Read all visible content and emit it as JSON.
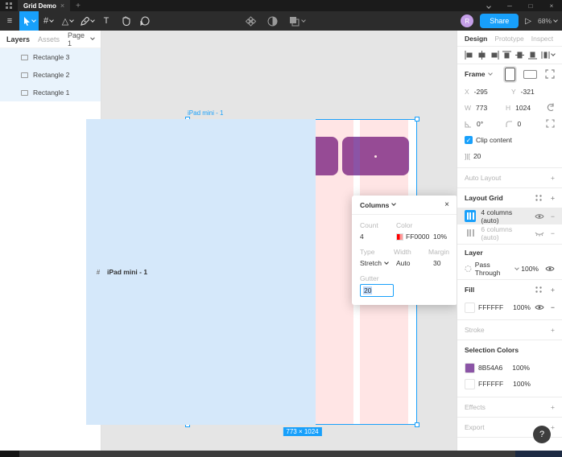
{
  "titlebar": {
    "tab": "Grid Demo",
    "close_tab": "×",
    "new_tab": "+",
    "window": {
      "minimize": "─",
      "maximize": "□",
      "close": "×"
    }
  },
  "toolbar": {
    "menu": "≡",
    "frame_tool": "#",
    "shape_tool": "△",
    "text_tool": "T",
    "avatar": "R",
    "share": "Share",
    "present": "▷",
    "zoom": "68%"
  },
  "left_sidebar": {
    "tabs": [
      "Layers",
      "Assets"
    ],
    "page": "Page 1",
    "layers": [
      "iPad mini - 1",
      "Rectangle 3",
      "Rectangle 2",
      "Rectangle 1"
    ]
  },
  "canvas": {
    "frame_label": "iPad mini - 1",
    "size_badge": "773 × 1024"
  },
  "columns_popup": {
    "title": "Columns",
    "close": "×",
    "count_label": "Count",
    "color_label": "Color",
    "count": "4",
    "color_hex": "FF0000",
    "color_opacity": "10%",
    "type_label": "Type",
    "width_label": "Width",
    "margin_label": "Margin",
    "type": "Stretch",
    "width": "Auto",
    "margin": "30",
    "gutter_label": "Gutter",
    "gutter": "20"
  },
  "inspector": {
    "tabs": [
      "Design",
      "Prototype",
      "Inspect"
    ],
    "frame": {
      "title": "Frame",
      "x_label": "X",
      "x": "-295",
      "y_label": "Y",
      "y": "-321",
      "w_label": "W",
      "w": "773",
      "h_label": "H",
      "h": "1024",
      "rotation": "0°",
      "radius": "0",
      "clip_label": "Clip content",
      "gutter_icon": "]|[",
      "gutter": "20"
    },
    "auto_layout_label": "Auto Layout",
    "layout_grid": {
      "title": "Layout Grid",
      "rows": [
        {
          "label": "4 columns (auto)"
        },
        {
          "label": "6 columns (auto)"
        }
      ]
    },
    "layer": {
      "title": "Layer",
      "blend": "Pass Through",
      "opacity": "100%"
    },
    "fill": {
      "title": "Fill",
      "hex": "FFFFFF",
      "opacity": "100%"
    },
    "stroke_label": "Stroke",
    "selection_colors": {
      "title": "Selection Colors",
      "items": [
        {
          "hex": "8B54A6",
          "opacity": "100%"
        },
        {
          "hex": "FFFFFF",
          "opacity": "100%"
        }
      ]
    },
    "effects_label": "Effects",
    "export_label": "Export"
  },
  "help": "?",
  "colors": {
    "accent": "#18A0FB",
    "selection_purple": "#8B54A6",
    "grid_red": "#FF0000",
    "fill_white": "#FFFFFF"
  }
}
